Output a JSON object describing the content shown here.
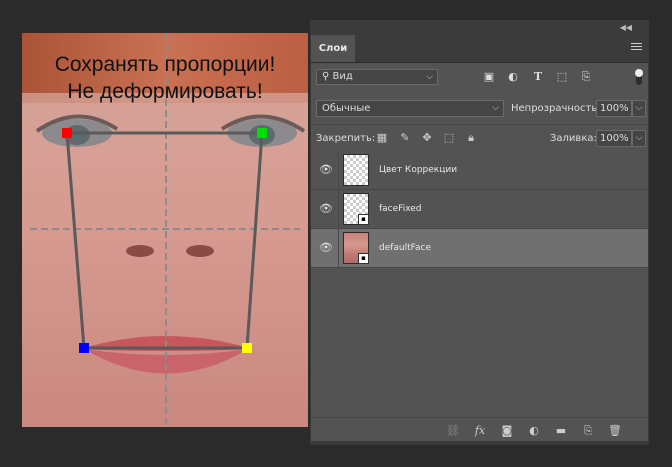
{
  "canvas": {
    "line1": "Сохранять пропорции!",
    "line2": "Не деформировать!",
    "markers": {
      "top_left": "#ff0000",
      "top_right": "#00e000",
      "bottom_left": "#0000ff",
      "bottom_right": "#ffff00"
    }
  },
  "panel": {
    "tab": "Слои",
    "collapse_icon": "double-chevron",
    "filter": {
      "label": "Вид",
      "icons": [
        "image",
        "circle-half",
        "T",
        "transform",
        "smart-object"
      ]
    },
    "blend_mode": "Обычные",
    "opacity_label": "Непрозрачность:",
    "opacity_value": "100%",
    "lock_label": "Закрепить:",
    "fill_label": "Заливка:",
    "fill_value": "100%",
    "layers": [
      {
        "name": "Цвет Коррекции",
        "thumb": "checker",
        "smart": false,
        "selected": false
      },
      {
        "name": "faceFixed",
        "thumb": "checker",
        "smart": true,
        "selected": false
      },
      {
        "name": "defaultFace",
        "thumb": "face",
        "smart": true,
        "selected": true
      }
    ],
    "bottom_icons": [
      "link",
      "fx",
      "mask",
      "adjustment",
      "folder",
      "new-layer",
      "trash"
    ]
  }
}
